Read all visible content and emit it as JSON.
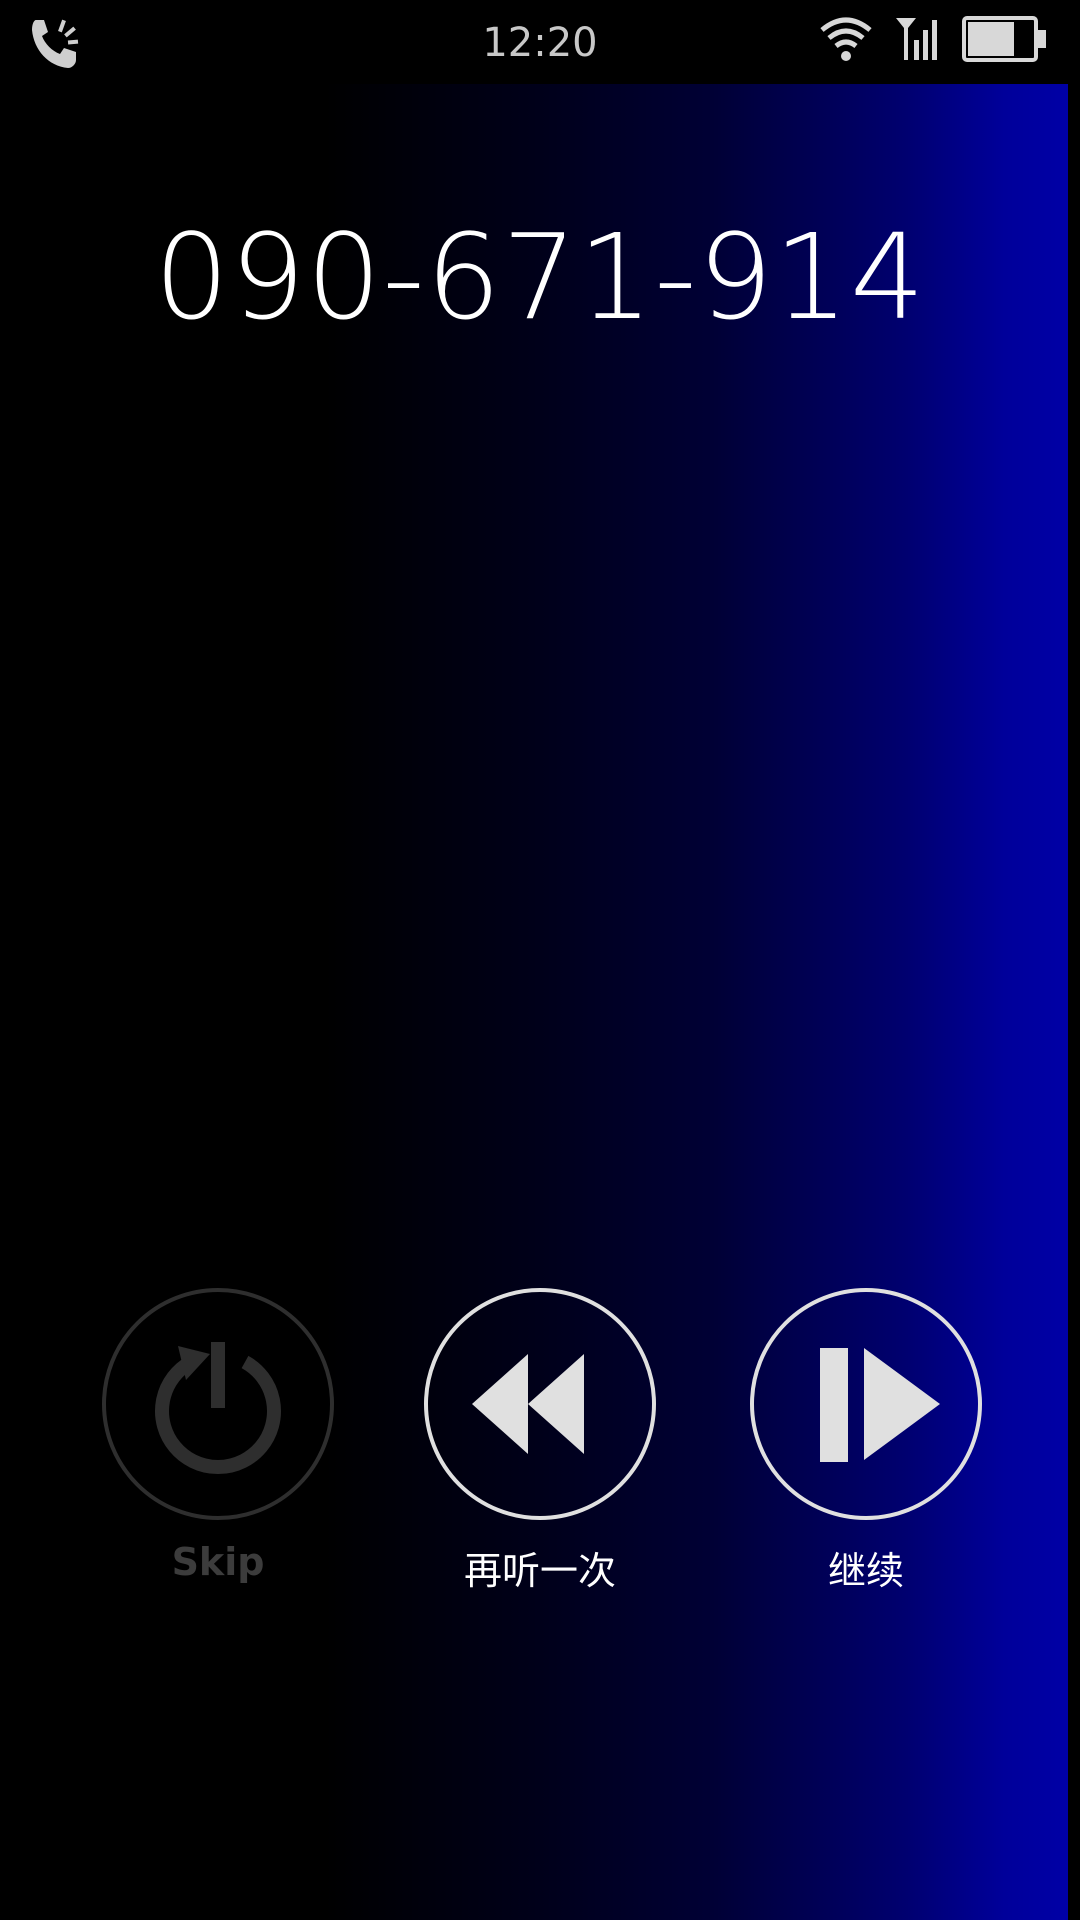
{
  "status_bar": {
    "time": "12:20",
    "icons": [
      "call-icon",
      "wifi-icon",
      "signal-icon",
      "battery-icon"
    ]
  },
  "call": {
    "number": "090-671-914"
  },
  "controls": {
    "skip": {
      "label": "Skip",
      "icon": "power-icon",
      "enabled": false
    },
    "replay": {
      "label": "再听一次",
      "icon": "rewind-icon",
      "enabled": true
    },
    "continue": {
      "label": "继续",
      "icon": "play-pause-icon",
      "enabled": true
    }
  },
  "colors": {
    "background_dark": "#000000",
    "background_blue": "#0000a8",
    "ring": "#e0e0e0",
    "disabled": "#2e2e2e"
  }
}
